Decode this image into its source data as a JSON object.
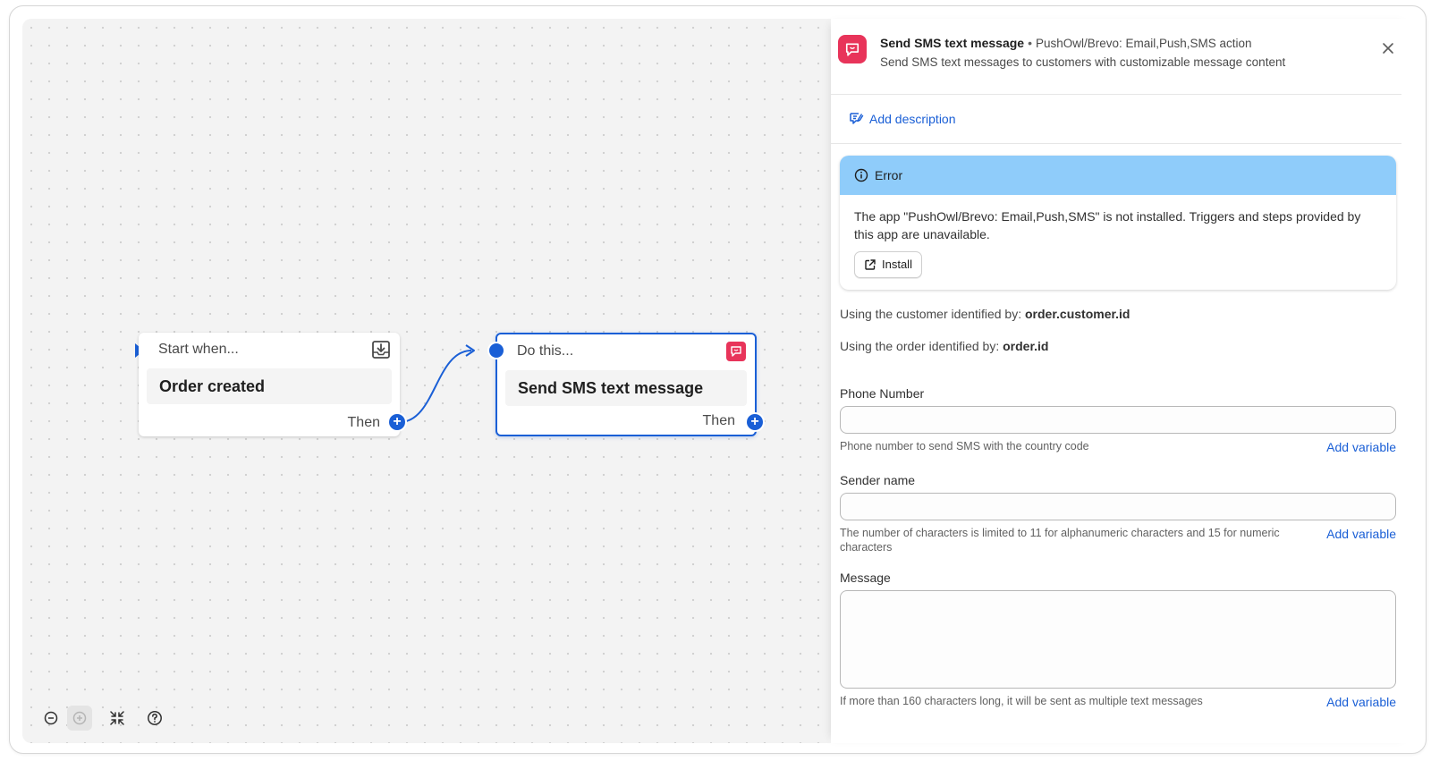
{
  "canvas": {
    "trigger_node": {
      "header": "Start when...",
      "title": "Order created",
      "then_label": "Then",
      "icon": "download-tray-icon"
    },
    "action_node": {
      "header": "Do this...",
      "title": "Send SMS text message",
      "then_label": "Then",
      "icon": "sms-chat-icon"
    },
    "controls": [
      "zoom-out-icon",
      "zoom-in-icon",
      "fit-view-icon",
      "help-icon"
    ]
  },
  "panel": {
    "title": "Send SMS text message",
    "separator": "•",
    "source": "PushOwl/Brevo: Email,Push,SMS action",
    "description": "Send SMS text messages to customers with customizable message content",
    "add_description": "Add description",
    "error": {
      "heading": "Error",
      "message": "The app \"PushOwl/Brevo: Email,Push,SMS\" is not installed. Triggers and steps provided by this app are unavailable.",
      "install_label": "Install"
    },
    "customer_line": {
      "prefix": "Using the customer identified by: ",
      "value": "order.customer.id"
    },
    "order_line": {
      "prefix": "Using the order identified by: ",
      "value": "order.id"
    },
    "fields": {
      "phone": {
        "label": "Phone Number",
        "value": "",
        "help": "Phone number to send SMS with the country code",
        "add_variable": "Add variable"
      },
      "sender": {
        "label": "Sender name",
        "value": "",
        "help": "The number of characters is limited to 11 for alphanumeric characters and 15 for numeric characters",
        "add_variable": "Add variable"
      },
      "message": {
        "label": "Message",
        "value": "",
        "help": "If more than 160 characters long, it will be sent as multiple text messages",
        "add_variable": "Add variable"
      }
    }
  },
  "colors": {
    "accent": "#1a5fd6",
    "app_icon": "#e8345a",
    "error_banner": "#8fccfa"
  }
}
